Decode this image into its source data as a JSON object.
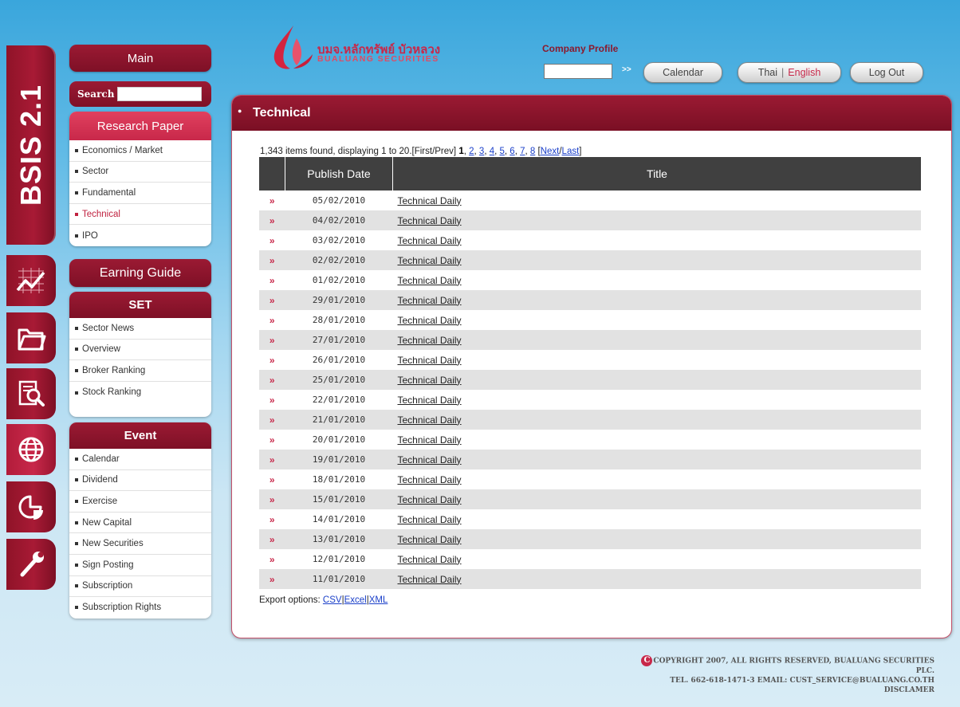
{
  "brand": {
    "title": "BSIS 2.1"
  },
  "menu": {
    "main_label": "Main",
    "search_label": "Search",
    "search_value": "",
    "research": {
      "title": "Research Paper",
      "items": [
        {
          "label": "Economics / Market"
        },
        {
          "label": "Sector"
        },
        {
          "label": "Fundamental"
        },
        {
          "label": "Technical",
          "active": true
        },
        {
          "label": "IPO"
        }
      ]
    },
    "earning_label": "Earning Guide",
    "set": {
      "title": "SET",
      "items": [
        {
          "label": "Sector News"
        },
        {
          "label": "Overview"
        },
        {
          "label": "Broker Ranking"
        },
        {
          "label": "Stock Ranking"
        }
      ]
    },
    "event": {
      "title": "Event",
      "items": [
        {
          "label": "Calendar"
        },
        {
          "label": "Dividend"
        },
        {
          "label": "Exercise"
        },
        {
          "label": "New Capital"
        },
        {
          "label": "New Securities"
        },
        {
          "label": "Sign Posting"
        },
        {
          "label": "Subscription"
        },
        {
          "label": "Subscription Rights"
        }
      ]
    }
  },
  "header": {
    "logo_th": "บมจ.หลักทรัพย์ บัวหลวง",
    "logo_en": "BUALUANG SECURITIES",
    "company_profile_label": "Company Profile",
    "company_profile_value": "",
    "go_label": ">>",
    "calendar_btn": "Calendar",
    "lang_thai": "Thai",
    "lang_sep": "|",
    "lang_english": "English",
    "logout_btn": "Log Out"
  },
  "content": {
    "title": "Technical",
    "paging": {
      "summary": "1,343 items found, displaying 1 to 20.",
      "first_prev": "[First/Prev]",
      "current": "1",
      "pages": [
        "2",
        "3",
        "4",
        "5",
        "6",
        "7",
        "8"
      ],
      "next": "Next",
      "last": "Last"
    },
    "table": {
      "col_date": "Publish Date",
      "col_title": "Title",
      "row_marker": "»",
      "rows": [
        {
          "date": "05/02/2010",
          "title": "Technical Daily"
        },
        {
          "date": "04/02/2010",
          "title": "Technical Daily"
        },
        {
          "date": "03/02/2010",
          "title": "Technical Daily"
        },
        {
          "date": "02/02/2010",
          "title": "Technical Daily"
        },
        {
          "date": "01/02/2010",
          "title": "Technical Daily"
        },
        {
          "date": "29/01/2010",
          "title": "Technical Daily"
        },
        {
          "date": "28/01/2010",
          "title": "Technical Daily"
        },
        {
          "date": "27/01/2010",
          "title": "Technical Daily"
        },
        {
          "date": "26/01/2010",
          "title": "Technical Daily"
        },
        {
          "date": "25/01/2010",
          "title": "Technical Daily"
        },
        {
          "date": "22/01/2010",
          "title": "Technical Daily"
        },
        {
          "date": "21/01/2010",
          "title": "Technical Daily"
        },
        {
          "date": "20/01/2010",
          "title": "Technical Daily"
        },
        {
          "date": "19/01/2010",
          "title": "Technical Daily"
        },
        {
          "date": "18/01/2010",
          "title": "Technical Daily"
        },
        {
          "date": "15/01/2010",
          "title": "Technical Daily"
        },
        {
          "date": "14/01/2010",
          "title": "Technical Daily"
        },
        {
          "date": "13/01/2010",
          "title": "Technical Daily"
        },
        {
          "date": "12/01/2010",
          "title": "Technical Daily"
        },
        {
          "date": "11/01/2010",
          "title": "Technical Daily"
        }
      ]
    },
    "export": {
      "label": "Export options:",
      "csv": "CSV",
      "excel": "Excel",
      "xml": "XML"
    }
  },
  "footer": {
    "copyright_mark": "C",
    "line1": "COPYRIGHT 2007, ALL RIGHTS RESERVED, BUALUANG SECURITIES PLC.",
    "line2": "TEL. 662-618-1471-3 EMAIL: CUST_SERVICE@BUALUANG.CO.TH",
    "line3": "DISCLAMER"
  },
  "side_tabs": [
    {
      "icon": "stock-chart-icon",
      "active": false
    },
    {
      "icon": "folder-icon",
      "active": false
    },
    {
      "icon": "document-search-icon",
      "active": false
    },
    {
      "icon": "globe-icon",
      "active": true
    },
    {
      "icon": "pie-chart-icon",
      "active": false
    },
    {
      "icon": "wrench-icon",
      "active": false
    }
  ],
  "colors": {
    "accent": "#8b1a2e",
    "accent_light": "#c8284a",
    "table_header": "#404040",
    "row_alt": "#e2e2e2",
    "link": "#1a3fc9"
  }
}
